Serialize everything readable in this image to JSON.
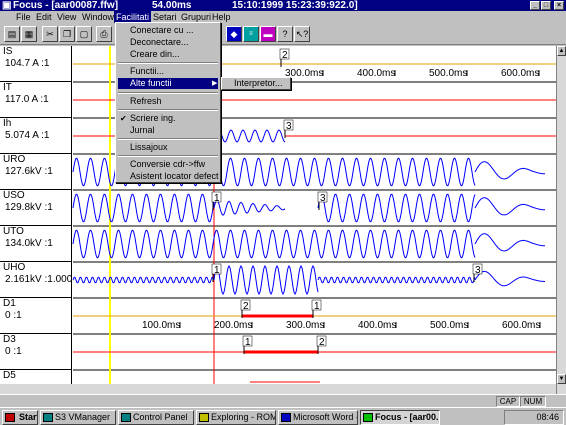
{
  "window": {
    "title": "Focus - [aar00087.ffw]",
    "duration": "54.00ms",
    "timestamp": "15:10:1999 15:23:39:922.0]",
    "controls": {
      "minimize": "_",
      "maximize": "□",
      "close": "×"
    }
  },
  "menubar": {
    "items": [
      "File",
      "Edit",
      "View",
      "Window",
      "Facilitati",
      "Setari",
      "Grupuri",
      "Help"
    ],
    "active": "Facilitati"
  },
  "menu": {
    "items": [
      {
        "label": "Conectare cu ..."
      },
      {
        "label": "Deconectare..."
      },
      {
        "label": "Creare din..."
      },
      {
        "label": "Functii..."
      },
      {
        "label": "Alte functii",
        "submenu_arrow": "▶"
      },
      {
        "label": "Refresh"
      },
      {
        "label": "Scriere ing.",
        "check": "✔"
      },
      {
        "label": "Jurnal"
      },
      {
        "label": "Lissajoux"
      },
      {
        "label": "Conversie cdr->ffw"
      },
      {
        "label": "Asistent locator defect"
      }
    ],
    "submenu": {
      "label": "Interpretor..."
    }
  },
  "channels": [
    {
      "name": "IS",
      "value": "104.7 A :1"
    },
    {
      "name": "IT",
      "value": "117.0 A :1"
    },
    {
      "name": "Ih",
      "value": "5.074 A :1"
    },
    {
      "name": "URO",
      "value": "127.6kV :1"
    },
    {
      "name": "USO",
      "value": "129.8kV :1"
    },
    {
      "name": "UTO",
      "value": "134.0kV :1"
    },
    {
      "name": "UHO",
      "value": "2.161kV :1.000"
    },
    {
      "name": "D1",
      "value": "0 :1"
    },
    {
      "name": "D3",
      "value": "0 :1"
    },
    {
      "name": "D5",
      "value": ""
    }
  ],
  "time_axis_top": [
    "300.0ms",
    "400.0ms",
    "500.0ms",
    "600.0ms"
  ],
  "time_axis_bottom": [
    "100.0ms",
    "200.0ms",
    "300.0ms",
    "400.0ms",
    "500.0ms",
    "600.0ms"
  ],
  "markers": {
    "m1": "1",
    "m2": "2",
    "m3": "3"
  },
  "status": {
    "cap": "CAP",
    "num": "NUM"
  },
  "taskbar": {
    "start": "Start",
    "tasks": [
      "S3 VManager",
      "Control Panel",
      "Exploring - ROM...",
      "Microsoft Word -...",
      "Focus - [aar00..."
    ],
    "clock": "08:46"
  },
  "colors": {
    "trace": "#0000ff",
    "event": "#ff0000",
    "cursor_yellow": "#ffff00",
    "cursor_red": "#ff0000",
    "title": "#000080"
  },
  "toolbar_icons": [
    "open-icon",
    "save-icon",
    "cut-icon",
    "copy-icon",
    "paste-icon",
    "print-icon",
    "zoom-icon",
    "measure-icon",
    "filter-icon",
    "help-icon",
    "context-help-icon"
  ]
}
